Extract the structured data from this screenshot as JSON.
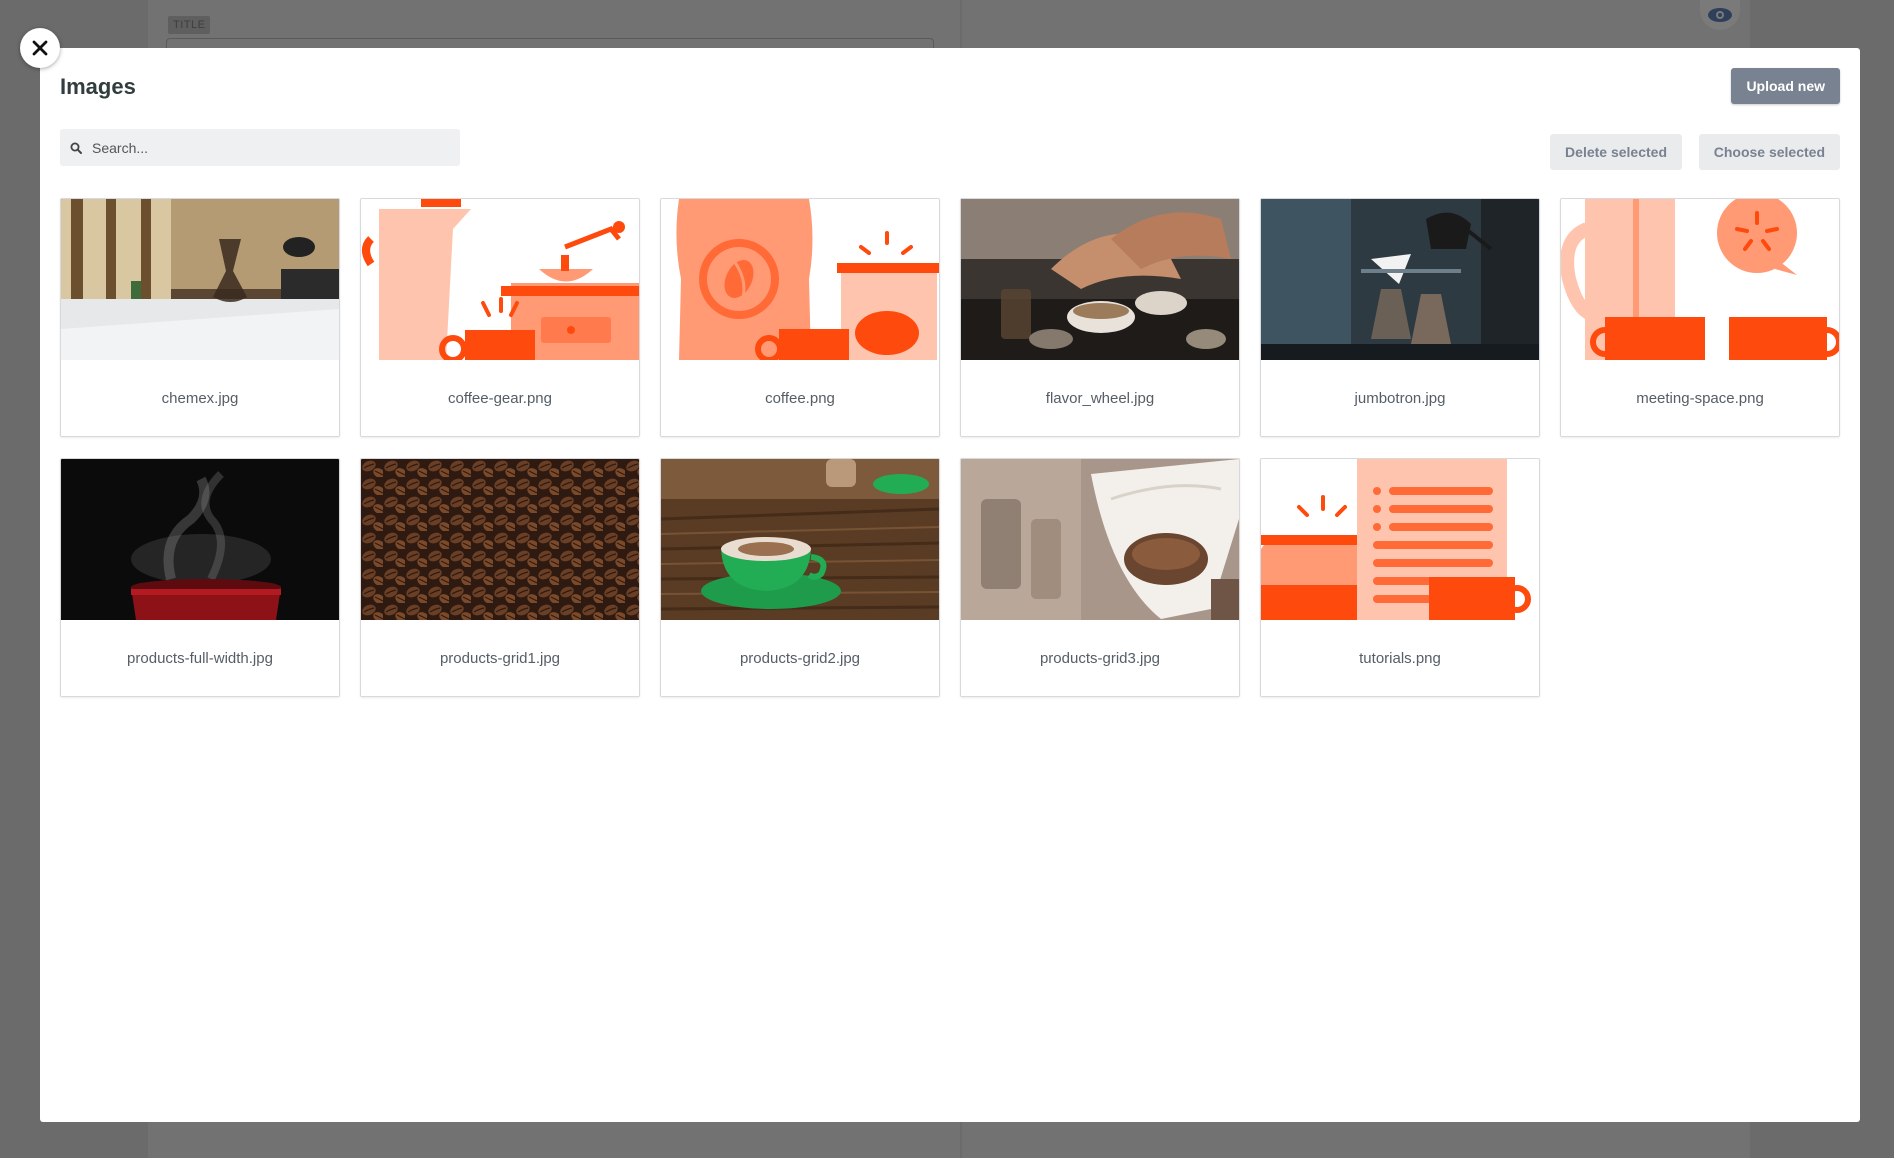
{
  "background": {
    "title_tag": "TITLE"
  },
  "modal": {
    "title": "Images",
    "upload_label": "Upload new",
    "search_placeholder": "Search...",
    "delete_label": "Delete selected",
    "choose_label": "Choose selected"
  },
  "images": [
    {
      "name": "chemex.jpg"
    },
    {
      "name": "coffee-gear.png"
    },
    {
      "name": "coffee.png"
    },
    {
      "name": "flavor_wheel.jpg"
    },
    {
      "name": "jumbotron.jpg"
    },
    {
      "name": "meeting-space.png"
    },
    {
      "name": "products-full-width.jpg"
    },
    {
      "name": "products-grid1.jpg"
    },
    {
      "name": "products-grid2.jpg"
    },
    {
      "name": "products-grid3.jpg"
    },
    {
      "name": "tutorials.png"
    }
  ],
  "colors": {
    "accent_orange": "#ff4a0d",
    "light_orange": "#ff9a75",
    "pale_orange": "#ffc4ad",
    "upload_button": "#798291"
  }
}
